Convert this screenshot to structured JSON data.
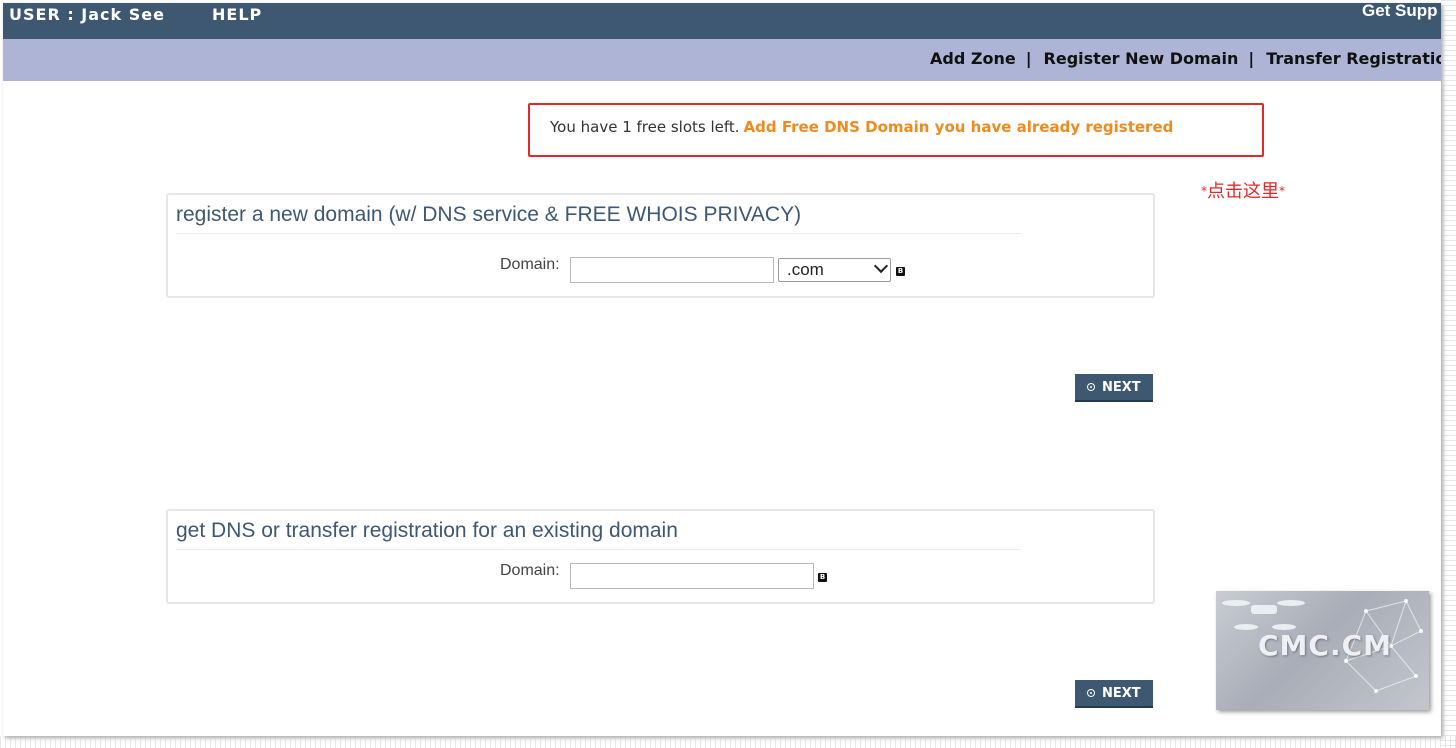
{
  "header": {
    "user_label": "USER : Jack See",
    "help_label": "HELP",
    "support_label": "Get Supp"
  },
  "subnav": {
    "items": [
      "Add Zone",
      "Register New Domain",
      "Transfer Registration"
    ],
    "separator": "|"
  },
  "notice": {
    "text": "You have 1 free slots left.",
    "link_label": "Add Free DNS Domain you have already registered"
  },
  "annotation": {
    "star": "*",
    "text": "点击这里"
  },
  "register_panel": {
    "title": "register a new domain (w/ DNS service & FREE WHOIS PRIVACY)",
    "domain_label": "Domain:",
    "domain_value": "",
    "tld_selected": ".com",
    "next_label": "NEXT"
  },
  "transfer_panel": {
    "title": "get DNS or transfer registration for an existing domain",
    "domain_label": "Domain:",
    "domain_value": "",
    "next_label": "NEXT"
  },
  "watermark": {
    "text": "CMC.CM"
  },
  "colors": {
    "topbar": "#3e5872",
    "subbar": "#aeb4d5",
    "accent_orange": "#ef8a1e",
    "alert_red": "#e3272a"
  },
  "icons": [
    "info-icon",
    "chevron-down-icon",
    "arrow-circle-icon"
  ]
}
